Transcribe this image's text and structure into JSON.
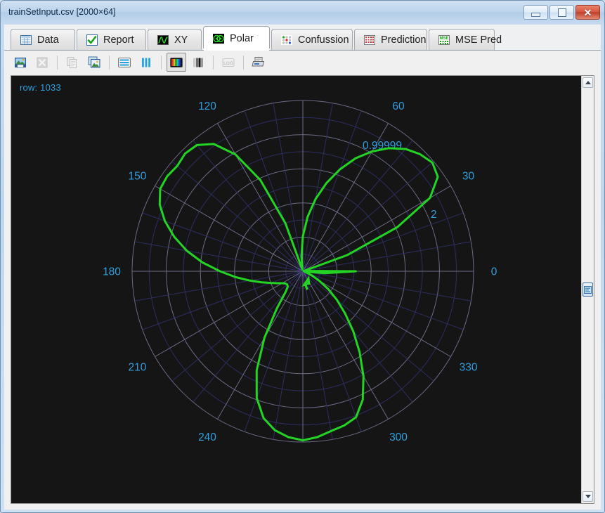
{
  "window": {
    "title": "trainSetInput.csv [2000×64]",
    "minimize_label": "Minimize",
    "maximize_label": "Maximize",
    "close_label": "Close"
  },
  "tabs": [
    {
      "label": "Data",
      "icon": "table-icon",
      "active": false
    },
    {
      "label": "Report",
      "icon": "checkmark-icon",
      "active": false
    },
    {
      "label": "XY",
      "icon": "waveform-icon",
      "active": false
    },
    {
      "label": "Polar",
      "icon": "polar-icon",
      "active": true
    },
    {
      "label": "Confussion",
      "icon": "confusion-icon",
      "active": false
    },
    {
      "label": "Prediction",
      "icon": "grid-red-icon",
      "active": false
    },
    {
      "label": "MSE Pred",
      "icon": "mse-icon",
      "active": false
    }
  ],
  "toolbar": [
    {
      "name": "save-image-button",
      "label": "Save image",
      "enabled": true,
      "selected": false
    },
    {
      "name": "export-excel-button",
      "label": "Export to Excel",
      "enabled": false,
      "selected": false
    },
    {
      "name": "copy-button",
      "label": "Copy",
      "enabled": false,
      "selected": false
    },
    {
      "name": "copy-image-button",
      "label": "Copy image",
      "enabled": true,
      "selected": false
    },
    {
      "name": "rows-view-button",
      "label": "Rows view",
      "enabled": true,
      "selected": false
    },
    {
      "name": "columns-view-button",
      "label": "Columns view",
      "enabled": true,
      "selected": false
    },
    {
      "name": "color-mode-button",
      "label": "Color mode",
      "enabled": true,
      "selected": true
    },
    {
      "name": "gray-mode-button",
      "label": "Grayscale mode",
      "enabled": true,
      "selected": false
    },
    {
      "name": "log-scale-button",
      "label": "LOG",
      "enabled": false,
      "selected": false
    },
    {
      "name": "print-button",
      "label": "Print",
      "enabled": true,
      "selected": false
    }
  ],
  "plot": {
    "row_label": "row: 1033",
    "colors": {
      "background": "#151515",
      "series": "#24d424",
      "major_grid": "#6b6b86",
      "minor_grid": "#2d2d63",
      "angle_label": "#2f9fe0",
      "radial_label": "#2f9fe0",
      "row_label": "#2f9fe0"
    }
  },
  "chart_data": {
    "type": "line",
    "projection": "polar",
    "title": "",
    "angle_unit": "degrees",
    "theta_direction": "counterclockwise",
    "theta_zero_location": "E",
    "angle_tick_labels": [
      "0",
      "30",
      "60",
      "120",
      "150",
      "180",
      "210",
      "240",
      "300",
      "330"
    ],
    "angle_tick_values": [
      0,
      30,
      60,
      120,
      150,
      180,
      210,
      240,
      300,
      330
    ],
    "angle_major_step": 30,
    "angle_minor_step": 10,
    "radial_tick_labels": [
      "0.99999",
      "2"
    ],
    "radial_tick_values": [
      0.99999,
      2.0
    ],
    "rlim": [
      0,
      2.0
    ],
    "radial_major_rings": 5,
    "radial_minor_rings": 10,
    "grid": true,
    "legend": false,
    "series": [
      {
        "name": "row 1033",
        "color": "#24d424",
        "theta": [
          0,
          5,
          10,
          15,
          20,
          25,
          30,
          35,
          40,
          45,
          50,
          55,
          60,
          65,
          70,
          75,
          80,
          85,
          90,
          95,
          100,
          105,
          110,
          115,
          120,
          125,
          130,
          135,
          140,
          145,
          150,
          155,
          160,
          165,
          170,
          175,
          180,
          185,
          190,
          195,
          200,
          205,
          210,
          215,
          220,
          225,
          230,
          235,
          240,
          245,
          250,
          255,
          260,
          265,
          270,
          275,
          280,
          285,
          290,
          295,
          300,
          305,
          310,
          315,
          320,
          325,
          330,
          335,
          340,
          345,
          350,
          355,
          360
        ],
        "r": [
          0.62,
          0.05,
          0.02,
          0.01,
          0.55,
          1.22,
          1.72,
          1.93,
          1.98,
          1.94,
          1.87,
          1.76,
          1.62,
          1.46,
          1.27,
          1.07,
          0.86,
          0.64,
          0.41,
          0.18,
          0.03,
          0.02,
          0.6,
          1.18,
          1.58,
          1.82,
          1.93,
          1.95,
          1.92,
          1.94,
          1.93,
          1.85,
          1.72,
          1.56,
          1.38,
          1.18,
          0.97,
          0.79,
          0.63,
          0.5,
          0.4,
          0.33,
          0.28,
          0.25,
          0.24,
          0.25,
          0.31,
          0.53,
          0.9,
          1.28,
          1.58,
          1.78,
          1.89,
          1.95,
          1.98,
          1.95,
          1.9,
          1.87,
          1.82,
          1.66,
          1.42,
          1.16,
          0.92,
          0.7,
          0.52,
          0.36,
          0.22,
          0.12,
          0.05,
          0.02,
          0.02,
          0.26,
          0.62
        ]
      }
    ]
  }
}
